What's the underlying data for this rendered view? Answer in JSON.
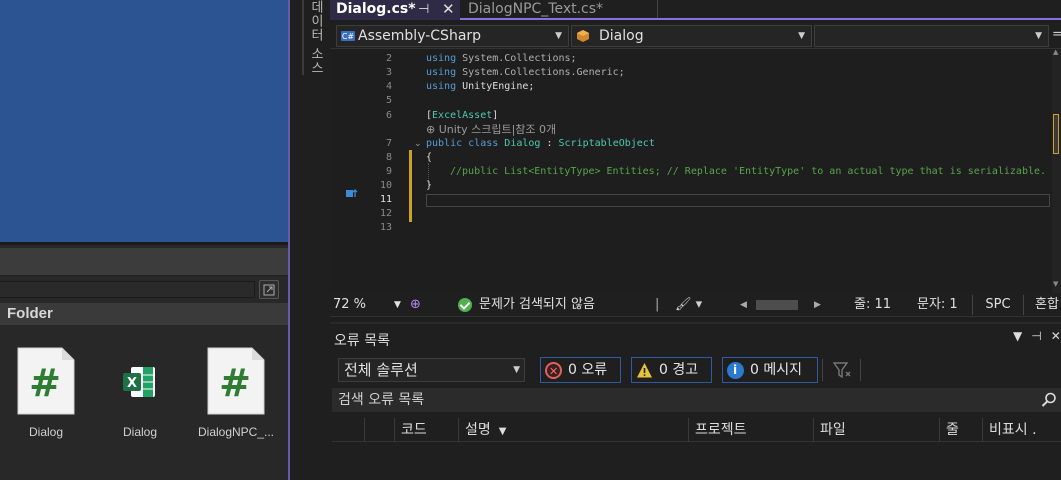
{
  "unity": {
    "folder_title": "Folder",
    "assets": [
      {
        "label": "Dialog",
        "kind": "csharp-script",
        "glyph": "#"
      },
      {
        "label": "Dialog",
        "kind": "excel-file",
        "glyph": "X"
      },
      {
        "label": "DialogNPC_...",
        "kind": "csharp-script",
        "glyph": "#"
      }
    ]
  },
  "side_tab": {
    "label": "데이터 소스"
  },
  "editor": {
    "tabs": [
      {
        "label": "Dialog.cs*",
        "pin": "⊣",
        "close": "✕"
      },
      {
        "label": "DialogNPC_Text.cs*"
      }
    ],
    "nav": {
      "project": "Assembly-CSharp",
      "class": "Dialog",
      "member": "",
      "split": "="
    },
    "codelens": "⊕ Unity 스크립트|참조 0개",
    "current_line": "11",
    "lines": [
      {
        "n": "2",
        "text": "using System.Collections;"
      },
      {
        "n": "3",
        "text": "using System.Collections.Generic;"
      },
      {
        "n": "4",
        "text": "using UnityEngine;"
      },
      {
        "n": "5",
        "text": ""
      },
      {
        "n": "6",
        "text": "[ExcelAsset]"
      },
      {
        "n": "7",
        "text": "public class Dialog : ScriptableObject"
      },
      {
        "n": "8",
        "text": "{"
      },
      {
        "n": "9",
        "text": "    //public List<EntityType> Entities; // Replace 'EntityType' to an actual type that is serializable."
      },
      {
        "n": "10",
        "text": "}"
      },
      {
        "n": "11",
        "text": ""
      },
      {
        "n": "12",
        "text": ""
      },
      {
        "n": "13",
        "text": ""
      }
    ],
    "tokens": {
      "using": "using",
      "public": "public",
      "class": "class",
      "colon": ":",
      "ns2": "System.Collections;",
      "ns3": "System.Collections.Generic;",
      "ns4": "UnityEngine;",
      "attr_open": "[",
      "attr_name": "ExcelAsset",
      "attr_close": "]",
      "class_name": "Dialog",
      "base_class": "ScriptableObject",
      "open_brace": "{",
      "close_brace": "}",
      "comment": "//public List<EntityType> Entities; // Replace 'EntityType' to an actual type that is serializable."
    },
    "status": {
      "zoom": "72 %",
      "issues": "문제가 검색되지 않음",
      "line": "줄: 11",
      "char": "문자: 1",
      "whitespace": "SPC",
      "line_endings": "혼합"
    }
  },
  "error_list": {
    "title": "오류 목록",
    "scope": "전체 솔루션",
    "errors_btn": "0 오류",
    "warnings_btn": "0 경고",
    "messages_btn": "0 메시지",
    "search_placeholder": "검색 오류 목록",
    "columns": [
      "코드",
      "설명",
      "프로젝트",
      "파일",
      "줄",
      "비표시 ."
    ]
  },
  "colors": {
    "unity_scene_blue": "#2c5392",
    "vs_accent": "#8a6fe0",
    "keyword": "#569cd6",
    "type": "#4ec9b0",
    "comment": "#57a64a",
    "cs_icon_green": "#2e7d32",
    "excel_green": "#1e7145"
  }
}
